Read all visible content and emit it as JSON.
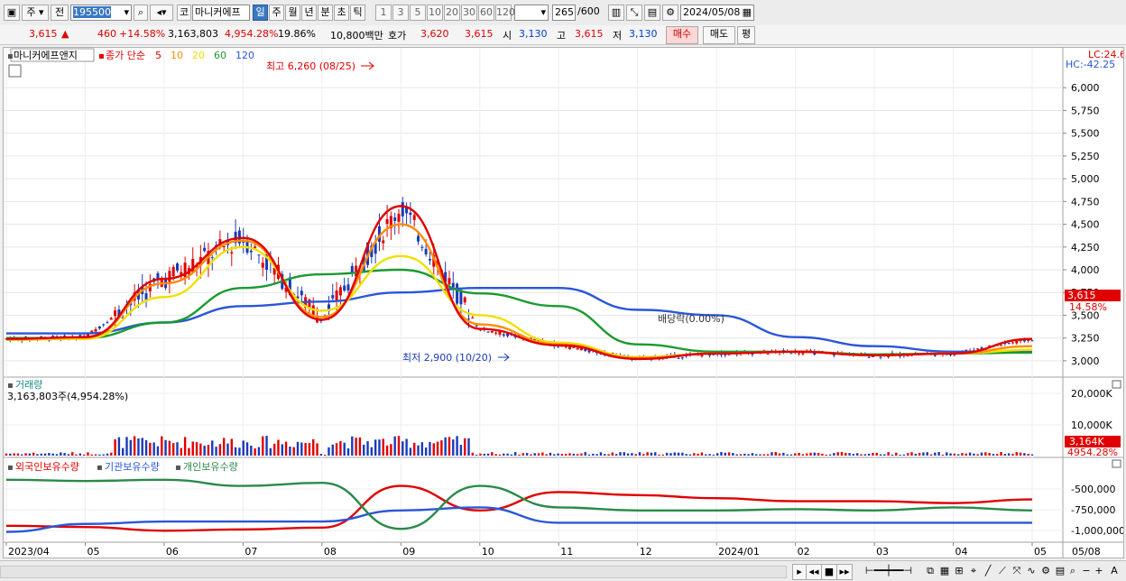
{
  "toolbar": {
    "market": "주",
    "prev_label": "전",
    "stock_code": "195500",
    "stock_type": "코",
    "stock_name": "마니커에프",
    "periods": [
      "일",
      "주",
      "월",
      "년",
      "분",
      "초",
      "틱"
    ],
    "active_period": "일",
    "intervals": [
      "1",
      "3",
      "5",
      "10",
      "20",
      "30",
      "60",
      "120"
    ],
    "count": "265",
    "total": "/600",
    "date": "2024/05/08"
  },
  "quote": {
    "price": "3,615",
    "change": "460",
    "change_pct": "+14.58%",
    "volume": "3,163,803",
    "volume_pct": "4,954.28%",
    "turnover": "19.86%",
    "amount": "10,800백만",
    "bid_label": "호가",
    "bid": "3,620",
    "ask": "3,615",
    "open_label": "시",
    "open": "3,130",
    "high_label": "고",
    "high": "3,615",
    "low_label": "저",
    "low": "3,130",
    "buy_label": "매수",
    "sell_label": "매도",
    "avg_label": "평"
  },
  "price_panel": {
    "name_tag": "마니커에프앤지",
    "ma_label": "종가 단순",
    "ma_periods": [
      "5",
      "10",
      "20",
      "60",
      "120"
    ],
    "ma_colors": [
      "#e00000",
      "#ff8c00",
      "#f0e000",
      "#1a9a30",
      "#2a56d8"
    ],
    "lc": "LC:24.66",
    "hc": "HC:-42.25",
    "high_note": "최고 6,260 (08/25)",
    "low_note": "최저 2,900 (10/20)",
    "dividend_note": "배당락(0.00%)",
    "last_price": "3,615",
    "last_pct": "14.58%",
    "y_ticks": [
      "6,000",
      "5,750",
      "5,500",
      "5,250",
      "5,000",
      "4,750",
      "4,500",
      "4,250",
      "4,000",
      "3,750",
      "3,500",
      "3,250",
      "3,000"
    ]
  },
  "volume_panel": {
    "title": "거래량",
    "value": "3,163,803주(4,954.28%)",
    "y_ticks": [
      "20,000K",
      "10,000K"
    ],
    "last_value": "3,164K",
    "last_pct": "4954.28%"
  },
  "holding_panel": {
    "series": [
      "외국인보유수량",
      "기관보유수량",
      "개인보유수량"
    ],
    "series_colors": [
      "#e00000",
      "#2a56d8",
      "#2a8a4a"
    ],
    "y_ticks": [
      "-500,000",
      "-750,000",
      "-1,000,000"
    ]
  },
  "x_axis": {
    "labels": [
      "2023/04",
      "05",
      "06",
      "07",
      "08",
      "09",
      "10",
      "11",
      "12",
      "2024/01",
      "02",
      "03",
      "04",
      "05"
    ],
    "right_label": "05/08"
  },
  "chart_data": {
    "type": "line",
    "x": [
      "2023/04",
      "2023/05",
      "2023/06",
      "2023/07",
      "2023/08",
      "2023/09",
      "2023/10",
      "2023/11",
      "2023/12",
      "2024/01",
      "2024/02",
      "2024/03",
      "2024/04",
      "2024/05"
    ],
    "series": [
      {
        "name": "5",
        "values": [
          3240,
          3260,
          3900,
          4350,
          3450,
          4700,
          3350,
          3170,
          3020,
          3080,
          3100,
          3060,
          3080,
          3240
        ]
      },
      {
        "name": "10",
        "values": [
          3235,
          3255,
          3850,
          4320,
          3480,
          4500,
          3400,
          3180,
          3030,
          3080,
          3100,
          3060,
          3080,
          3160
        ]
      },
      {
        "name": "20",
        "values": [
          3230,
          3240,
          3700,
          4250,
          3550,
          4150,
          3500,
          3200,
          3040,
          3080,
          3100,
          3060,
          3080,
          3120
        ]
      },
      {
        "name": "60",
        "values": [
          3250,
          3250,
          3420,
          3800,
          3950,
          4000,
          3740,
          3600,
          3180,
          3100,
          3100,
          3070,
          3080,
          3090
        ]
      },
      {
        "name": "120",
        "values": [
          3300,
          3300,
          3420,
          3600,
          3650,
          3750,
          3800,
          3800,
          3560,
          3500,
          3260,
          3160,
          3100,
          3100
        ]
      }
    ],
    "ylim": [
      2850,
      6260
    ]
  }
}
